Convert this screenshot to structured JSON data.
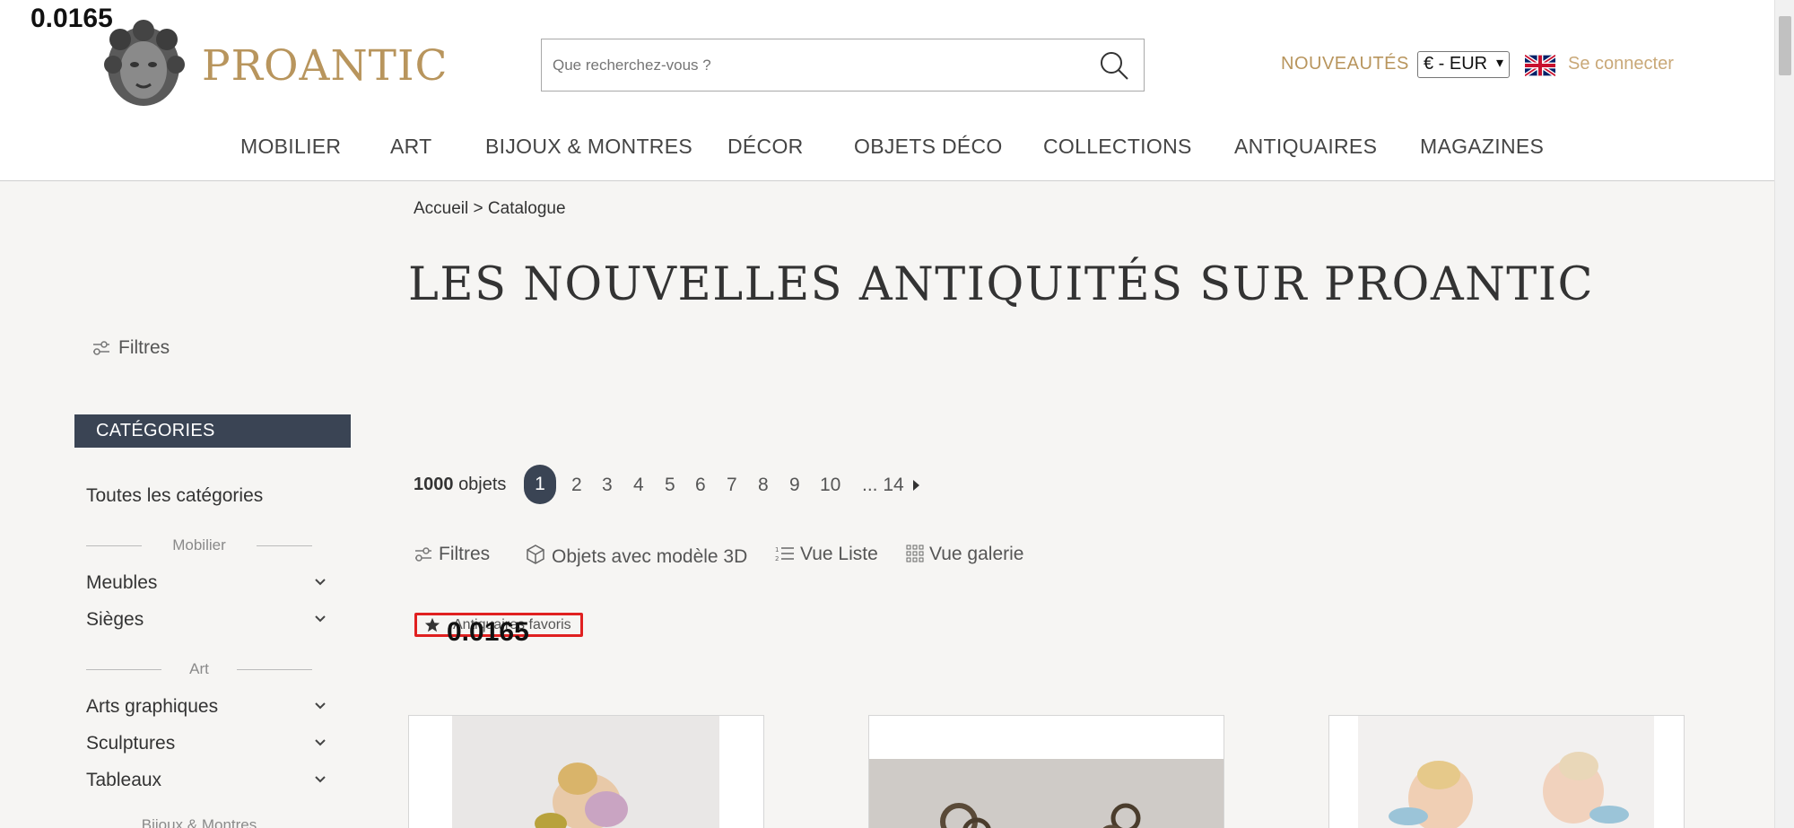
{
  "overlay": {
    "value": "0.0165"
  },
  "header": {
    "logo_text": "PROANTIC",
    "search_placeholder": "Que recherchez-vous ?",
    "nouveautes": "NOUVEAUTÉS",
    "currency": "€ - EUR",
    "connect": "Se connecter",
    "accent_color": "#b8955d"
  },
  "nav": [
    "MOBILIER",
    "ART",
    "BIJOUX & MONTRES",
    "DÉCOR",
    "OBJETS DÉCO",
    "COLLECTIONS",
    "ANTIQUAIRES",
    "MAGAZINES"
  ],
  "breadcrumb": {
    "home": "Accueil",
    "sep": ">",
    "current": "Catalogue"
  },
  "page_title": "LES NOUVELLES ANTIQUITÉS SUR PROANTIC",
  "sidebar": {
    "filters_label": "Filtres",
    "categories_header": "CATÉGORIES",
    "all_categories": "Toutes les catégories",
    "sections": [
      {
        "title": "Mobilier",
        "items": [
          "Meubles",
          "Sièges"
        ]
      },
      {
        "title": "Art",
        "items": [
          "Arts graphiques",
          "Sculptures",
          "Tableaux"
        ]
      },
      {
        "title": "Bijoux & Montres",
        "items": []
      }
    ]
  },
  "results": {
    "count": "1000",
    "count_label": "objets",
    "pages": [
      "1",
      "2",
      "3",
      "4",
      "5",
      "6",
      "7",
      "8",
      "9",
      "10",
      "... 14"
    ],
    "current_page": "1"
  },
  "toolbar": {
    "filters": "Filtres",
    "model3d": "Objets avec modèle 3D",
    "list_view": "Vue Liste",
    "gallery_view": "Vue galerie"
  },
  "favorites_chip": "Antiquaires favoris",
  "brand_dark": "#3a4454"
}
